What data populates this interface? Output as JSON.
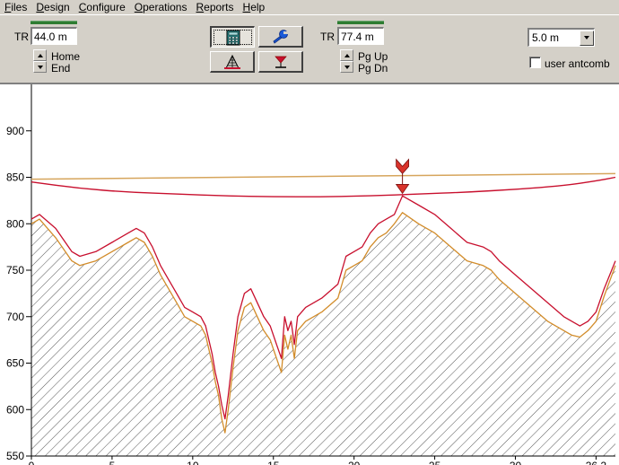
{
  "menu": [
    {
      "key": "F",
      "rest": "iles"
    },
    {
      "key": "D",
      "rest": "esign"
    },
    {
      "key": "C",
      "rest": "onfigure"
    },
    {
      "key": "O",
      "rest": "perations"
    },
    {
      "key": "R",
      "rest": "eports"
    },
    {
      "key": "H",
      "rest": "elp"
    }
  ],
  "left_site": {
    "tr_label": "TR",
    "height_value": "44.0 m",
    "spin_up_label": "Home",
    "spin_down_label": "End"
  },
  "right_site": {
    "tr_label": "TR",
    "height_value": "77.4 m",
    "spin_up_label": "Pg Up",
    "spin_down_label": "Pg Dn"
  },
  "tools": {
    "calculator": "calculator-icon",
    "wrench": "wrench-icon",
    "tower": "tower-icon",
    "antenna": "antenna-icon"
  },
  "step_select": {
    "value": "5.0 m"
  },
  "antcomb": {
    "label": "user antcomb",
    "checked": false
  },
  "colors": {
    "terrain": "#c8102e",
    "terrain_earth": "#d28c2a",
    "fresnel": "#c8102e",
    "los": "#d6a55c",
    "obstruction_marker": "#d9332b",
    "hatch": "#555555",
    "toolbar_green": "#2e7d32"
  },
  "chart_data": {
    "type": "line",
    "ylim": [
      550,
      950
    ],
    "xlim": [
      0,
      36.2
    ],
    "y_ticks": [
      550,
      600,
      650,
      700,
      750,
      800,
      850,
      900
    ],
    "x_ticks": [
      0,
      5,
      10,
      15,
      20,
      25,
      30,
      35
    ],
    "x_tick_labels": [
      "0",
      "5",
      "10",
      "15",
      "20",
      "25",
      "30",
      "36.2"
    ],
    "obstruction_x": 23.0,
    "series": [
      {
        "role": "terrain-profile",
        "x": [
          0,
          0.5,
          1.5,
          2.5,
          3.0,
          4.0,
          5.0,
          6.0,
          6.5,
          7.0,
          7.5,
          8.0,
          8.5,
          9.0,
          9.5,
          10.0,
          10.5,
          10.8,
          11.0,
          11.2,
          11.4,
          11.6,
          11.8,
          12.0,
          12.2,
          12.5,
          12.8,
          13.2,
          13.6,
          14.0,
          14.4,
          14.8,
          15.2,
          15.5,
          15.7,
          15.9,
          16.1,
          16.3,
          16.5,
          17.0,
          18.0,
          19.0,
          19.5,
          20.0,
          20.5,
          21.0,
          21.5,
          22.0,
          22.5,
          23.0,
          24.0,
          25.0,
          26.0,
          27.0,
          28.0,
          28.5,
          29.0,
          30.0,
          31.0,
          32.0,
          33.0,
          33.5,
          34.0,
          34.5,
          35.0,
          35.5,
          36.2
        ],
        "y": [
          805,
          810,
          795,
          770,
          765,
          770,
          780,
          790,
          795,
          790,
          775,
          755,
          740,
          725,
          710,
          705,
          700,
          690,
          675,
          660,
          640,
          625,
          605,
          590,
          615,
          660,
          700,
          725,
          730,
          715,
          700,
          690,
          670,
          655,
          700,
          685,
          695,
          670,
          700,
          710,
          720,
          735,
          765,
          770,
          775,
          790,
          800,
          805,
          810,
          830,
          820,
          810,
          795,
          780,
          775,
          770,
          760,
          745,
          730,
          715,
          700,
          695,
          690,
          695,
          705,
          730,
          760
        ]
      },
      {
        "role": "earth-curve-profile",
        "x": [
          0,
          0.5,
          1.5,
          2.5,
          3.0,
          4.0,
          5.0,
          6.0,
          6.5,
          7.0,
          7.5,
          8.0,
          8.5,
          9.0,
          9.5,
          10.0,
          10.5,
          10.8,
          11.0,
          11.2,
          11.4,
          11.6,
          11.8,
          12.0,
          12.2,
          12.5,
          12.8,
          13.2,
          13.6,
          14.0,
          14.4,
          14.8,
          15.2,
          15.5,
          15.7,
          15.9,
          16.1,
          16.3,
          16.5,
          17.0,
          18.0,
          19.0,
          19.5,
          20.0,
          20.5,
          21.0,
          21.5,
          22.0,
          22.5,
          23.0,
          24.0,
          25.0,
          26.0,
          27.0,
          28.0,
          28.5,
          29.0,
          30.0,
          31.0,
          32.0,
          33.0,
          33.5,
          34.0,
          34.5,
          35.0,
          35.5,
          36.2
        ],
        "y": [
          800,
          805,
          785,
          760,
          755,
          760,
          770,
          780,
          785,
          780,
          765,
          745,
          730,
          715,
          700,
          695,
          690,
          680,
          665,
          650,
          630,
          615,
          590,
          575,
          600,
          645,
          685,
          710,
          715,
          700,
          685,
          675,
          655,
          640,
          680,
          665,
          680,
          655,
          685,
          695,
          705,
          720,
          750,
          755,
          760,
          775,
          785,
          790,
          800,
          812,
          800,
          790,
          775,
          760,
          755,
          750,
          740,
          725,
          710,
          695,
          685,
          680,
          678,
          685,
          695,
          722,
          755
        ]
      },
      {
        "role": "line-of-sight",
        "x": [
          0,
          36.2
        ],
        "y": [
          848,
          854
        ]
      },
      {
        "role": "fresnel-zone",
        "x": [
          0,
          3,
          6,
          9,
          12,
          15,
          18,
          21,
          24,
          27,
          30,
          33,
          35,
          36.2
        ],
        "y": [
          845,
          838,
          834,
          832,
          830,
          829,
          829,
          830,
          832,
          834,
          837,
          841,
          846,
          850
        ]
      }
    ]
  }
}
